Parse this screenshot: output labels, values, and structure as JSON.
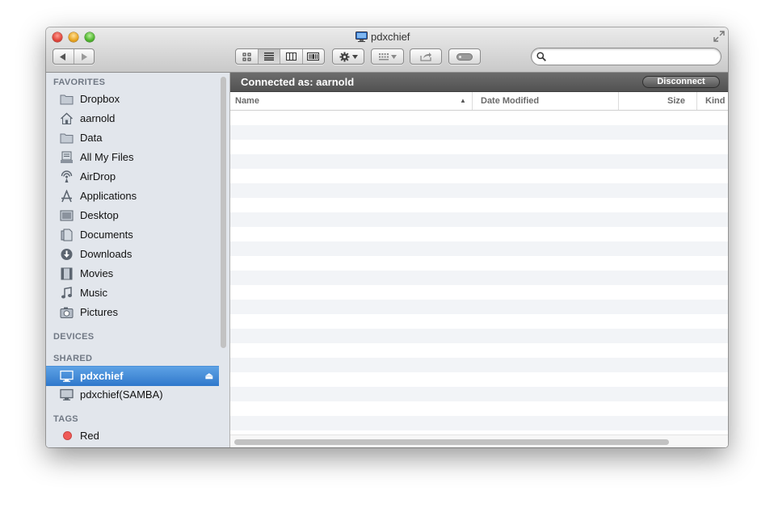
{
  "window": {
    "title": "pdxchief"
  },
  "toolbar": {
    "back_icon": "back-arrow-icon",
    "forward_icon": "forward-arrow-icon",
    "view_modes": [
      "icon-view",
      "list-view",
      "column-view",
      "cover-flow-view"
    ],
    "active_view": "list-view",
    "action_icon": "gear-icon",
    "arrange_icon": "arrange-grid-icon",
    "share_icon": "share-icon",
    "tag_icon": "tag-icon",
    "search": {
      "value": "",
      "placeholder": ""
    }
  },
  "sidebar": {
    "sections": {
      "favorites": "FAVORITES",
      "devices": "DEVICES",
      "shared": "SHARED",
      "tags": "TAGS"
    },
    "favorites": [
      {
        "label": "Dropbox",
        "icon": "folder-icon"
      },
      {
        "label": "aarnold",
        "icon": "home-icon"
      },
      {
        "label": "Data",
        "icon": "folder-icon"
      },
      {
        "label": "All My Files",
        "icon": "all-files-icon"
      },
      {
        "label": "AirDrop",
        "icon": "airdrop-icon"
      },
      {
        "label": "Applications",
        "icon": "applications-icon"
      },
      {
        "label": "Desktop",
        "icon": "desktop-icon"
      },
      {
        "label": "Documents",
        "icon": "documents-icon"
      },
      {
        "label": "Downloads",
        "icon": "downloads-icon"
      },
      {
        "label": "Movies",
        "icon": "movies-icon"
      },
      {
        "label": "Music",
        "icon": "music-icon"
      },
      {
        "label": "Pictures",
        "icon": "pictures-icon"
      }
    ],
    "shared": [
      {
        "label": "pdxchief",
        "icon": "computer-icon",
        "selected": true
      },
      {
        "label": "pdxchief(SAMBA)",
        "icon": "computer-icon",
        "selected": false
      }
    ],
    "tags": [
      {
        "label": "Red",
        "color": "#f05a57"
      }
    ]
  },
  "main": {
    "connected_label": "Connected as: aarnold",
    "disconnect_label": "Disconnect",
    "columns": [
      "Name",
      "Date Modified",
      "Size",
      "Kind"
    ],
    "sort_column": "Name",
    "sort_direction": "ascending"
  },
  "colors": {
    "selection": "#3a84d4",
    "sidebar_bg": "#e2e6ec",
    "connbar_bg": "#5e5e5e",
    "tag_red": "#f05a57"
  }
}
